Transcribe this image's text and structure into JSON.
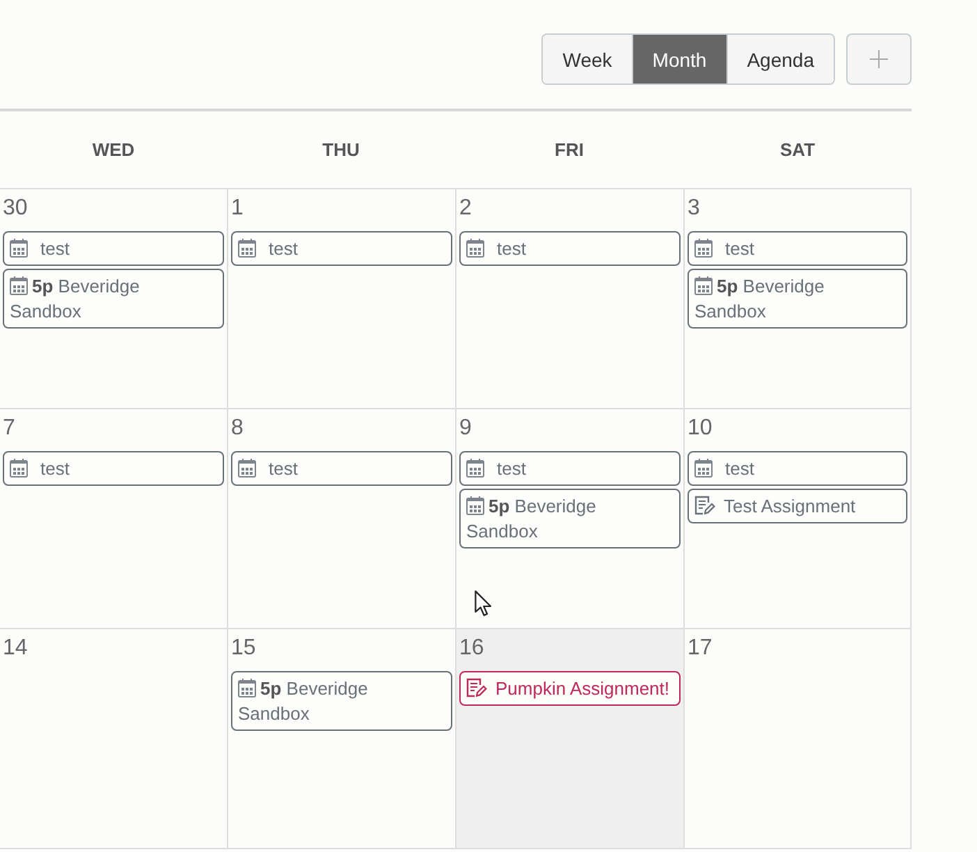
{
  "view_switcher": {
    "buttons": [
      {
        "label": "Week",
        "selected": false
      },
      {
        "label": "Month",
        "selected": true
      },
      {
        "label": "Agenda",
        "selected": false
      }
    ]
  },
  "calendar": {
    "weekdays": [
      "WED",
      "THU",
      "FRI",
      "SAT"
    ],
    "weeks": [
      {
        "days": [
          {
            "number": "30",
            "today": false,
            "events": [
              {
                "kind": "event",
                "title": "test",
                "color": "#687078"
              },
              {
                "kind": "event",
                "time": "5p",
                "title": "Beveridge Sandbox",
                "color": "#687078"
              }
            ]
          },
          {
            "number": "1",
            "today": false,
            "events": [
              {
                "kind": "event",
                "title": "test",
                "color": "#687078"
              }
            ]
          },
          {
            "number": "2",
            "today": false,
            "events": [
              {
                "kind": "event",
                "title": "test",
                "color": "#687078"
              }
            ]
          },
          {
            "number": "3",
            "today": false,
            "events": [
              {
                "kind": "event",
                "title": "test",
                "color": "#687078"
              },
              {
                "kind": "event",
                "time": "5p",
                "title": "Beveridge Sandbox",
                "color": "#687078"
              }
            ]
          }
        ]
      },
      {
        "days": [
          {
            "number": "7",
            "today": false,
            "events": [
              {
                "kind": "event",
                "title": "test",
                "color": "#687078"
              }
            ]
          },
          {
            "number": "8",
            "today": false,
            "events": [
              {
                "kind": "event",
                "title": "test",
                "color": "#687078"
              }
            ]
          },
          {
            "number": "9",
            "today": false,
            "events": [
              {
                "kind": "event",
                "title": "test",
                "color": "#687078"
              },
              {
                "kind": "event",
                "time": "5p",
                "title": "Beveridge Sandbox",
                "color": "#687078"
              }
            ]
          },
          {
            "number": "10",
            "today": false,
            "events": [
              {
                "kind": "event",
                "title": "test",
                "color": "#687078"
              },
              {
                "kind": "assignment",
                "title": "Test Assignment",
                "color": "#687078"
              }
            ]
          }
        ]
      },
      {
        "days": [
          {
            "number": "14",
            "today": false
          },
          {
            "number": "15",
            "today": false,
            "events": [
              {
                "kind": "event",
                "time": "5p",
                "title": "Beveridge Sandbox",
                "color": "#687078"
              }
            ]
          },
          {
            "number": "16",
            "today": true,
            "events": [
              {
                "kind": "assignment",
                "title": "Pumpkin Assignment!",
                "color": "#c0285a"
              }
            ]
          },
          {
            "number": "17",
            "today": false
          }
        ]
      }
    ]
  }
}
